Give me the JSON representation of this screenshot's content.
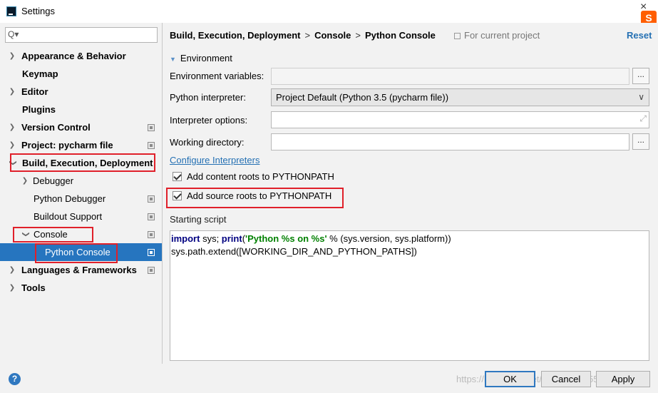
{
  "window": {
    "title": "Settings",
    "close_glyph": "×",
    "ime_badge": "S"
  },
  "search": {
    "placeholder": "",
    "glyph": "Q▾"
  },
  "sidebar": {
    "items": [
      {
        "label": "Appearance & Behavior"
      },
      {
        "label": "Keymap"
      },
      {
        "label": "Editor"
      },
      {
        "label": "Plugins"
      },
      {
        "label": "Version Control"
      },
      {
        "label": "Project: pycharm file"
      },
      {
        "label": "Build, Execution, Deployment"
      },
      {
        "label": "Debugger"
      },
      {
        "label": "Python Debugger"
      },
      {
        "label": "Buildout Support"
      },
      {
        "label": "Console"
      },
      {
        "label": "Python Console"
      },
      {
        "label": "Languages & Frameworks"
      },
      {
        "label": "Tools"
      }
    ]
  },
  "header": {
    "crumbs": [
      "Build, Execution, Deployment",
      "Python Console"
    ],
    "console_crumb": "Console",
    "separator": ">",
    "for_project": "For current project",
    "reset": "Reset"
  },
  "form": {
    "section": "Environment",
    "env_vars_label": "Environment variables:",
    "env_vars_value": "",
    "interpreter_label": "Python interpreter:",
    "interpreter_value": "Project Default (Python 3.5 (pycharm file))",
    "options_label": "Interpreter options:",
    "options_value": "",
    "workdir_label": "Working directory:",
    "workdir_value": "",
    "browse": "...",
    "configure_link": "Configure Interpreters",
    "cb_content": "Add content roots to PYTHONPATH",
    "cb_source": "Add source roots to PYTHONPATH",
    "starting_script_label": "Starting script"
  },
  "script": {
    "kw_import": "import",
    "sys_semicolon": " sys; ",
    "kw_print": "print",
    "open_paren": "(",
    "fmt_string": "'Python %s on %s'",
    "rest_line1": " % (sys.version, sys.platform))",
    "line2": "sys.path.extend([WORKING_DIR_AND_PYTHON_PATHS])"
  },
  "footer": {
    "help": "?",
    "ok": "OK",
    "cancel": "Cancel",
    "apply": "Apply",
    "watermark": "https://blog.csdn.net/weixin_43955964"
  },
  "icons": {
    "tree_expanded": "chevron-down-icon",
    "tree_collapsed": "chevron-right-icon",
    "project_level": "project-settings-icon"
  },
  "colors": {
    "selection": "#2675bf",
    "link": "#2470b3",
    "annotation_box": "#e0202a"
  }
}
